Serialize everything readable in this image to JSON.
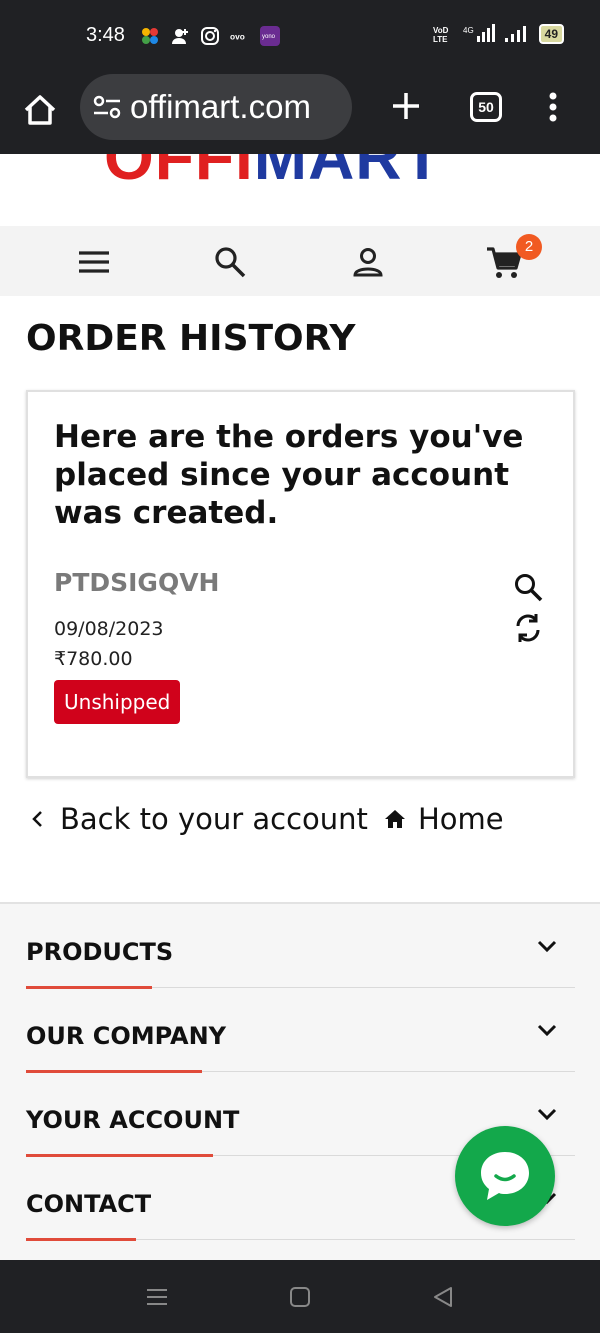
{
  "status_bar": {
    "time": "3:48",
    "network": "4G",
    "battery": "49"
  },
  "browser": {
    "url": "offimart.com",
    "tab_count": "50"
  },
  "site": {
    "logo_part_red": "OFFI",
    "logo_part_blue": "MART",
    "cart_count": "2"
  },
  "page": {
    "title": "ORDER HISTORY"
  },
  "orders": {
    "intro": "Here are the orders you've placed since your account was created.",
    "items": [
      {
        "reference": "PTDSIGQVH",
        "date": "09/08/2023",
        "total": "₹780.00",
        "status": "Unshipped"
      }
    ]
  },
  "links": {
    "back": "Back to your account",
    "home": "Home"
  },
  "footer": {
    "sections": [
      {
        "label": "PRODUCTS",
        "underline_pct": 23
      },
      {
        "label": "OUR COMPANY",
        "underline_pct": 32
      },
      {
        "label": "YOUR ACCOUNT",
        "underline_pct": 34
      },
      {
        "label": "CONTACT",
        "underline_pct": 20
      }
    ]
  },
  "colors": {
    "status_red": "#d0021b",
    "accent_red": "#e04b3a",
    "chat_green": "#13a84b",
    "badge_orange": "#f15a22"
  },
  "icons": {
    "status_left": [
      "mosaic-app-icon",
      "add-contact-icon",
      "instagram-icon",
      "ovo-icon",
      "yono-icon"
    ],
    "nav": [
      "hamburger-menu-icon",
      "search-icon",
      "user-icon",
      "cart-icon"
    ]
  }
}
